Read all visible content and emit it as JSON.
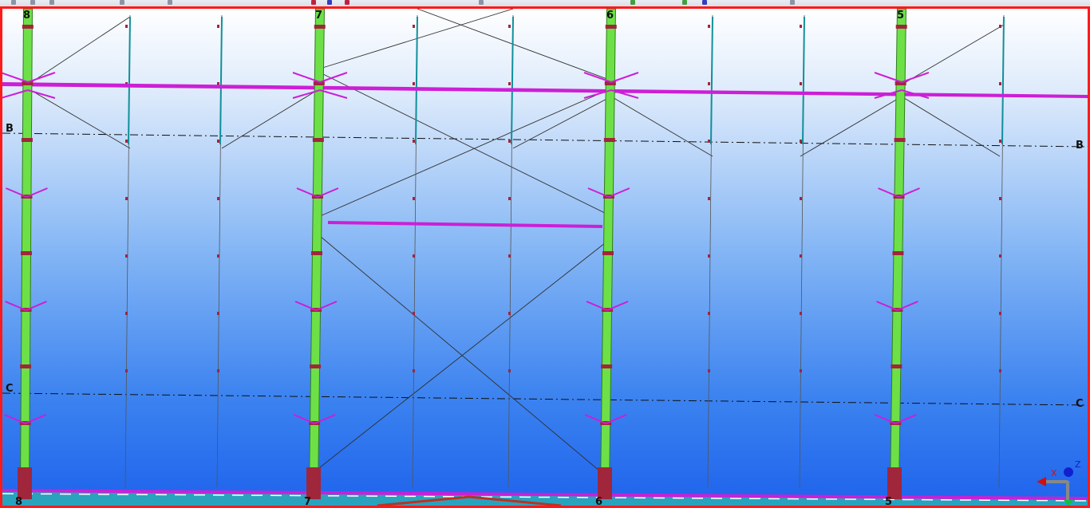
{
  "app": {
    "view_description_visible": false
  },
  "viewport": {
    "border_color": "#ff1a1a",
    "background_top": "#ffffff",
    "background_bottom": "#1e63ec"
  },
  "grids": {
    "columns": [
      "8",
      "7",
      "6",
      "5"
    ],
    "rows": [
      "B",
      "C"
    ]
  },
  "colors": {
    "column": "#6de048",
    "column_outline": "#2f7d1a",
    "beam": "#cc1fd6",
    "brace": "#303030",
    "girt": "#10909a",
    "connection": "#a0263c",
    "gridline": "#101010",
    "floor": "#2aa8b8"
  },
  "axis_indicator": {
    "x_label": "X",
    "z_label": "Z",
    "x_color": "#d01010",
    "y_color": "#1020d0",
    "z_color": "#10c040"
  }
}
